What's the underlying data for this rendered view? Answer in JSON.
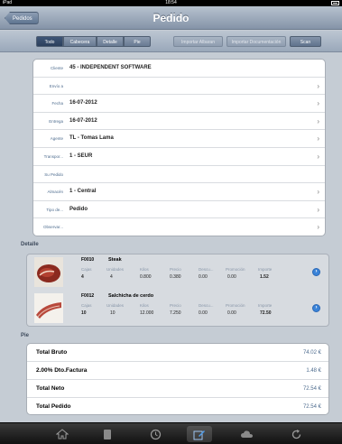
{
  "status": {
    "carrier": "iPad",
    "time": "18:54"
  },
  "navbar": {
    "title": "Pedido",
    "back_label": "Pedidos"
  },
  "toolbar": {
    "segments": [
      "Todo",
      "Cabecera",
      "Detalle",
      "Pie"
    ],
    "btn_copy": "Importar Albaran",
    "btn_history": "Importar Documentación",
    "btn_scan": "Scan"
  },
  "header": {
    "rows": [
      {
        "label": "Cliente",
        "value": "45 - INDEPENDENT SOFTWARE"
      },
      {
        "label": "Envío a",
        "value": ""
      },
      {
        "label": "Fecha",
        "value": "16-07-2012"
      },
      {
        "label": "Entrega",
        "value": "16-07-2012"
      },
      {
        "label": "Agente",
        "value": "TL - Tomas Lama"
      },
      {
        "label": "Transpor...",
        "value": "1 - SEUR"
      },
      {
        "label": "Su Pedido",
        "value": ""
      },
      {
        "label": "Almacén",
        "value": "1 - Central"
      },
      {
        "label": "Tipo de...",
        "value": "Pedido"
      },
      {
        "label": "Observar...",
        "value": ""
      }
    ]
  },
  "detail": {
    "title": "Detalle",
    "columns": [
      "Cajas",
      "Unidades",
      "Kilos",
      "Precio",
      "Descu...",
      "Promoción",
      "Importe"
    ],
    "items": [
      {
        "code": "F0010",
        "name": "Steak",
        "values": [
          "4",
          "4",
          "0.800",
          "0.380",
          "0.00",
          "0.00",
          "1.52"
        ]
      },
      {
        "code": "F0012",
        "name": "Salchicha de cerdo",
        "values": [
          "10",
          "10",
          "12.000",
          "7.250",
          "0.00",
          "0.00",
          "72.50"
        ]
      }
    ]
  },
  "totals": {
    "title": "Pie",
    "rows": [
      {
        "label": "Total Bruto",
        "value": "74.02 €"
      },
      {
        "label": "2.00% Dto.Factura",
        "value": "1.48 €"
      },
      {
        "label": "Total Neto",
        "value": "72.54 €"
      },
      {
        "label": "Total Pedido",
        "value": "72.54 €"
      }
    ]
  },
  "tabbar": {
    "icons": [
      "home-icon",
      "document-icon",
      "clock-icon",
      "edit-icon",
      "cloud-icon",
      "refresh-icon"
    ],
    "active_index": 3
  }
}
